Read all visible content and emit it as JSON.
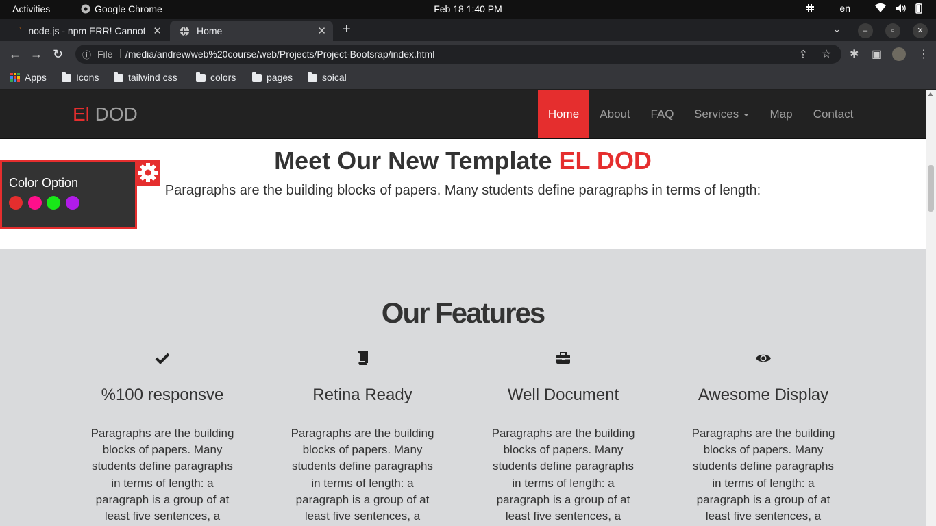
{
  "system": {
    "activities": "Activities",
    "app_name": "Google Chrome",
    "clock": "Feb 18  1:40 PM",
    "language": "en"
  },
  "tabs": [
    {
      "label": "node.js - npm ERR! Cannot"
    },
    {
      "label": "Home"
    }
  ],
  "address": {
    "scheme_label": "File",
    "url": "/media/andrew/web%20course/web/Projects/Project-Bootsrap/index.html"
  },
  "bookmarks": [
    "Apps",
    "Icons",
    "tailwind css",
    "colors",
    "pages",
    "soical"
  ],
  "site": {
    "logo_accent": "El",
    "logo_rest": " DOD",
    "nav": [
      "Home",
      "About",
      "FAQ",
      "Services",
      "Map",
      "Contact"
    ],
    "accent_color": "#e52e2e"
  },
  "hero": {
    "title_prefix": "Meet Our New Template ",
    "title_accent": "EL DOD",
    "text": "Paragraphs are the building blocks of papers. Many students define paragraphs in terms of length:"
  },
  "color_option": {
    "label": "Color Option",
    "swatches": [
      "#e52e2e",
      "#ff0f8b",
      "#18e818",
      "#b11be8"
    ]
  },
  "features": {
    "title": "Our Features",
    "items": [
      {
        "icon": "check-icon",
        "title": "%100 responsve",
        "text": "Paragraphs are the building blocks of papers. Many students define paragraphs in terms of length: a paragraph is a group of at least five sentences, a"
      },
      {
        "icon": "book-icon",
        "title": "Retina Ready",
        "text": "Paragraphs are the building blocks of papers. Many students define paragraphs in terms of length: a paragraph is a group of at least five sentences, a"
      },
      {
        "icon": "briefcase-icon",
        "title": "Well Document",
        "text": "Paragraphs are the building blocks of papers. Many students define paragraphs in terms of length: a paragraph is a group of at least five sentences, a"
      },
      {
        "icon": "eye-icon",
        "title": "Awesome Display",
        "text": "Paragraphs are the building blocks of papers. Many students define paragraphs in terms of length: a paragraph is a group of at least five sentences, a"
      }
    ]
  }
}
